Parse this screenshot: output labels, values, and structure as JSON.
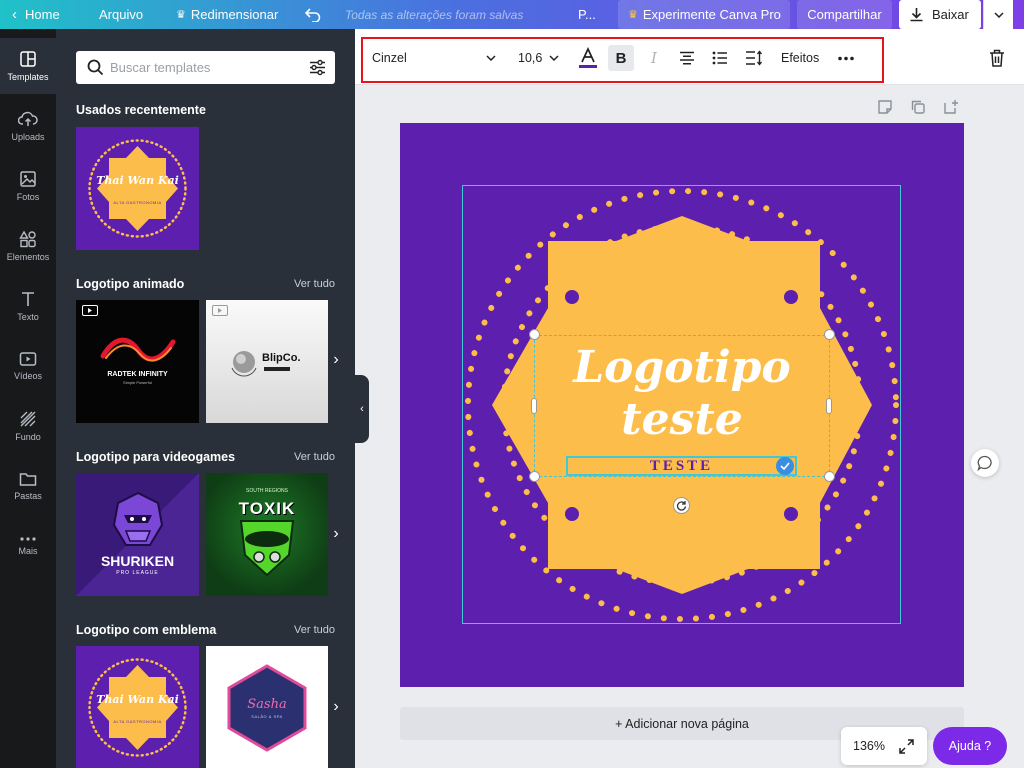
{
  "topbar": {
    "home": "Home",
    "arquivo": "Arquivo",
    "redimensionar": "Redimensionar",
    "saved_status": "Todas as alterações foram salvas",
    "project": "P...",
    "try_pro": "Experimente Canva Pro",
    "share": "Compartilhar",
    "download": "Baixar"
  },
  "rail": [
    {
      "label": "Templates",
      "icon": "templates-icon",
      "active": true
    },
    {
      "label": "Uploads",
      "icon": "upload-cloud-icon"
    },
    {
      "label": "Fotos",
      "icon": "photo-icon"
    },
    {
      "label": "Elementos",
      "icon": "shapes-icon"
    },
    {
      "label": "Texto",
      "icon": "text-icon"
    },
    {
      "label": "Vídeos",
      "icon": "video-icon"
    },
    {
      "label": "Fundo",
      "icon": "background-icon"
    },
    {
      "label": "Pastas",
      "icon": "folder-icon"
    },
    {
      "label": "Mais",
      "icon": "more-icon"
    }
  ],
  "panel": {
    "search_placeholder": "Buscar templates",
    "see_all": "Ver tudo",
    "sections": [
      {
        "title": "Usados recentemente"
      },
      {
        "title": "Logotipo animado"
      },
      {
        "title": "Logotipo para videogames"
      },
      {
        "title": "Logotipo com emblema"
      }
    ],
    "thumbs": {
      "thai_name": "Thai Wan Kai",
      "thai_sub": "ALTA GASTRONOMIA",
      "radtek": "RADTEK INFINITY",
      "radtek_sub": "Simple Powerful",
      "blipco": "BlipCo.",
      "shuriken": "SHURIKEN",
      "shuriken_sub": "PRO LEAGUE",
      "toxik": "TOXIK",
      "toxik_sub": "SOUTH REGIONS",
      "sasha": "Sasha",
      "sasha_sub": "SALÃO & SPA"
    }
  },
  "text_toolbar": {
    "font": "Cinzel",
    "size": "10,6",
    "effects": "Efeitos"
  },
  "canvas": {
    "title_line1": "Logotipo",
    "title_line2": "teste",
    "subtitle": "TESTE",
    "add_page": "+ Adicionar nova página",
    "zoom": "136%",
    "help": "Ajuda ?"
  },
  "colors": {
    "purple": "#5c1fae",
    "gold": "#fdbd4a",
    "accent": "#7d2ae8",
    "selection": "#3fc8d8",
    "highlight_red": "#e8141c"
  }
}
